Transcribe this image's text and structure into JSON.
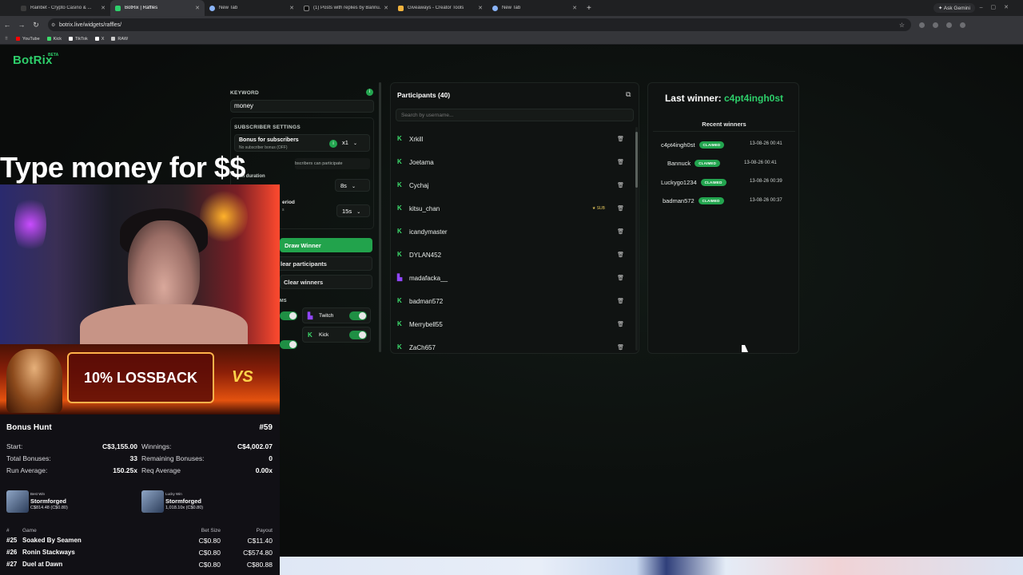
{
  "browser": {
    "tabs": [
      {
        "label": "Rainbet - Crypto Casino & ...",
        "color": "#3b3b3b",
        "active": false
      },
      {
        "label": "BotRix | Raffles",
        "color": "#2ecf6b",
        "active": true
      },
      {
        "label": "New Tab",
        "color": "#8ab4f8",
        "active": false
      },
      {
        "label": "(1) Posts with replies by Bannu...",
        "color": "#000000",
        "active": false
      },
      {
        "label": "Giveaways - Creator Tools",
        "color": "#f2b33d",
        "active": false
      },
      {
        "label": "New Tab",
        "color": "#8ab4f8",
        "active": false
      }
    ],
    "new_tab_glyph": "+",
    "ask_gemini": "Ask Gemini",
    "url": "botrix.live/widgets/raffles/",
    "bookmarks": [
      {
        "label": "YouTube",
        "color": "#ff0000"
      },
      {
        "label": "Kick",
        "color": "#3ddc6c"
      },
      {
        "label": "TikTok",
        "color": "#ffffff"
      },
      {
        "label": "X",
        "color": "#ffffff"
      },
      {
        "label": "RAW",
        "color": "#cccccc"
      }
    ]
  },
  "app": {
    "logo": "BotRix",
    "beta": "BETA",
    "accent": "#2ecf6b"
  },
  "settings": {
    "keyword_label": "KEYWORD",
    "keyword_value": "money",
    "subscriber_settings_label": "SUBSCRIBER SETTINGS",
    "bonus_title": "Bonus for subscribers",
    "bonus_sub": "No subscriber bonus (OFF)",
    "bonus_mult": "x1",
    "sub_only_text": "bscribers can participate",
    "spin_label": "Spin duration",
    "spin_value": "8s",
    "period_label": "eriod",
    "period_sub": "s",
    "period_value": "15s",
    "draw_winner": "Draw Winner",
    "clear_participants": "lear participants",
    "clear_winners": "Clear winners",
    "platforms_label": "MS",
    "platform_twitch": "Twitch",
    "platform_kick": "Kick"
  },
  "participants": {
    "title": "Participants (40)",
    "search_placeholder": "Search by username...",
    "sub_badge": "SUB",
    "items": [
      {
        "name": "Xrkill",
        "platform": "kick",
        "sub": false
      },
      {
        "name": "Joetama",
        "platform": "kick",
        "sub": false
      },
      {
        "name": "Cychaj",
        "platform": "kick",
        "sub": false
      },
      {
        "name": "kitsu_chan",
        "platform": "kick",
        "sub": true
      },
      {
        "name": "icandymaster",
        "platform": "kick",
        "sub": false
      },
      {
        "name": "DYLAN452",
        "platform": "kick",
        "sub": false
      },
      {
        "name": "madafacka__",
        "platform": "twitch",
        "sub": false
      },
      {
        "name": "badman572",
        "platform": "kick",
        "sub": false
      },
      {
        "name": "Merrybell55",
        "platform": "kick",
        "sub": false
      },
      {
        "name": "ZaCh657",
        "platform": "kick",
        "sub": false
      }
    ]
  },
  "winners": {
    "last_winner_label": "Last winner:",
    "last_winner_name": "c4pt4ingh0st",
    "recent_label": "Recent winners",
    "claimed_label": "CLAIMED",
    "items": [
      {
        "name": "c4pt4ingh0st",
        "time": "13-08-26 00:41"
      },
      {
        "name": "Bannuck",
        "time": "13-08-26 00:41"
      },
      {
        "name": "Luckygo1234",
        "time": "13-08-26 00:39"
      },
      {
        "name": "badman572",
        "time": "13-08-26 00:37"
      }
    ]
  },
  "overlay": {
    "title": "Type money for $$",
    "banner_text": "10% LOSSBACK",
    "banner_vs": "VS"
  },
  "hunt": {
    "title": "Bonus Hunt",
    "number": "#59",
    "start_label": "Start:",
    "start_value": "C$3,155.00",
    "winnings_label": "Winnings:",
    "winnings_value": "C$4,002.07",
    "total_label": "Total Bonuses:",
    "total_value": "33",
    "remaining_label": "Remaining Bonuses:",
    "remaining_value": "0",
    "run_label": "Run Average:",
    "run_value": "150.25x",
    "req_label": "Req Average",
    "req_value": "0.00x",
    "best_win_label": "Best Win",
    "best_win_game": "Stormforged",
    "best_win_value": "C$814.48 (C$0.80)",
    "lucky_win_label": "Lucky Win",
    "lucky_win_game": "Stormforged",
    "lucky_win_value": "1,018.10x (C$0.80)",
    "col_num": "#",
    "col_game": "Game",
    "col_bet": "Bet Size",
    "col_payout": "Payout",
    "games": [
      {
        "num": "#25",
        "name": "Soaked By Seamen",
        "bet": "C$0.80",
        "payout": "C$11.40"
      },
      {
        "num": "#26",
        "name": "Ronin Stackways",
        "bet": "C$0.80",
        "payout": "C$574.80"
      },
      {
        "num": "#27",
        "name": "Duel at Dawn",
        "bet": "C$0.80",
        "payout": "C$80.88"
      }
    ]
  }
}
